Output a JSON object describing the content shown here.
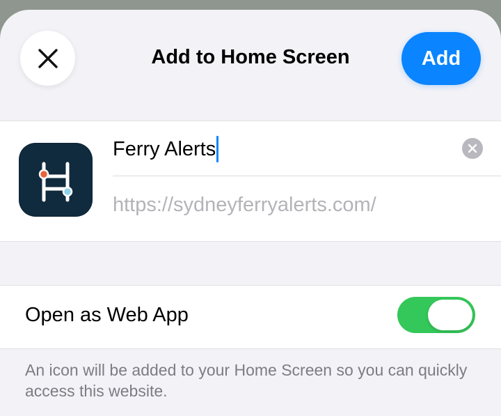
{
  "header": {
    "title": "Add to Home Screen",
    "add_label": "Add",
    "close_icon": "close-icon"
  },
  "bookmark": {
    "name_value": "Ferry Alerts",
    "url": "https://sydneyferryalerts.com/",
    "icon": "ferry-alerts-app-icon",
    "clear_icon": "clear-text-icon"
  },
  "options": {
    "open_as_web_app_label": "Open as Web App",
    "open_as_web_app_on": true
  },
  "footer": {
    "note": "An icon will be added to your Home Screen so you can quickly access this website."
  },
  "colors": {
    "accent": "#0a84ff",
    "toggle_on": "#34c759",
    "icon_bg": "#102a3e"
  }
}
